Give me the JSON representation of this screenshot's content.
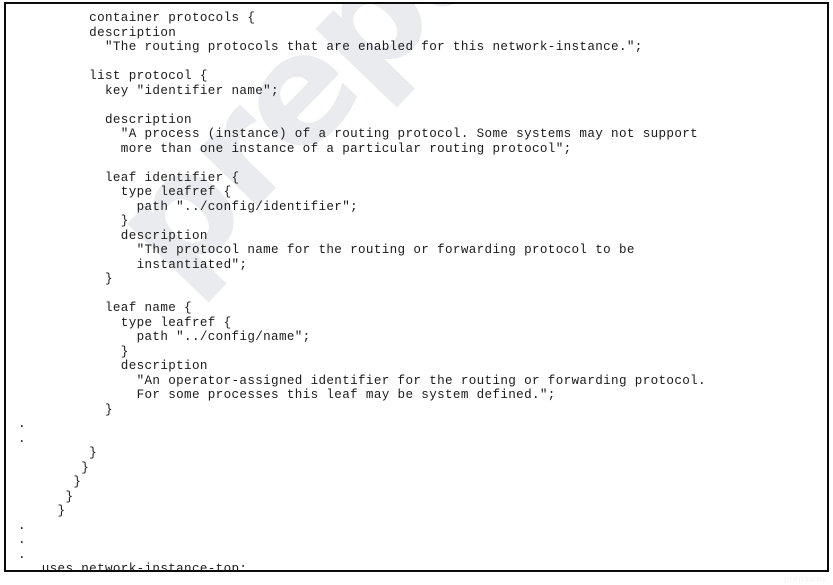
{
  "document": {
    "kind": "code-listing",
    "language": "yang",
    "watermark": "prepaway",
    "footer_watermark": "prepaway"
  },
  "code": {
    "lines": [
      "         container protocols {",
      "         description",
      "           \"The routing protocols that are enabled for this network-instance.\";",
      "",
      "         list protocol {",
      "           key \"identifier name\";",
      "",
      "           description",
      "             \"A process (instance) of a routing protocol. Some systems may not support",
      "             more than one instance of a particular routing protocol\";",
      "",
      "           leaf identifier {",
      "             type leafref {",
      "               path \"../config/identifier\";",
      "             }",
      "             description",
      "               \"The protocol name for the routing or forwarding protocol to be",
      "               instantiated\";",
      "           }",
      "",
      "           leaf name {",
      "             type leafref {",
      "               path \"../config/name\";",
      "             }",
      "             description",
      "               \"An operator-assigned identifier for the routing or forwarding protocol.",
      "               For some processes this leaf may be system defined.\";",
      "           }",
      ".",
      ".",
      "         }",
      "        }",
      "       }",
      "      }",
      "     }",
      ".",
      ".",
      ".",
      "   uses network-instance-top;",
      " }"
    ]
  }
}
